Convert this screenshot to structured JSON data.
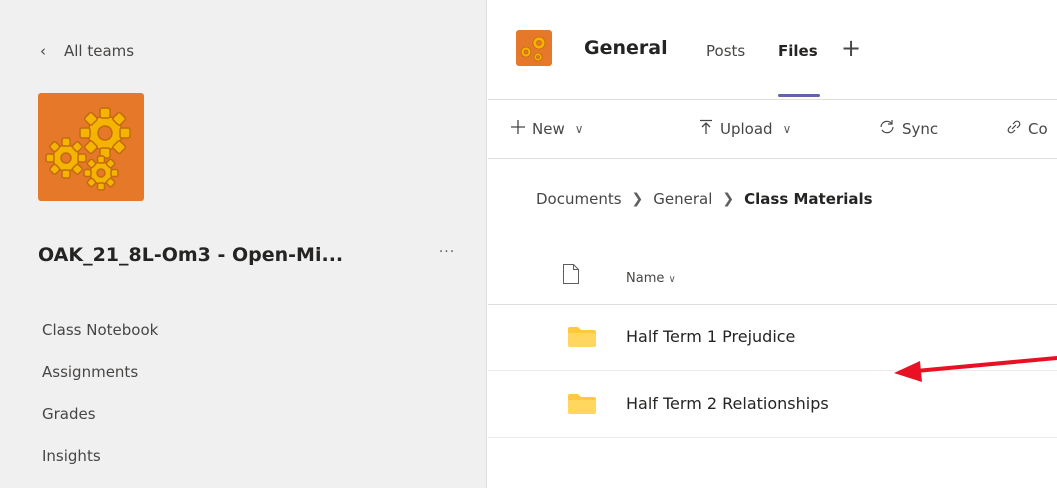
{
  "sidebar": {
    "back_label": "All teams",
    "team_name": "OAK_21_8L-Om3 - Open-Mi...",
    "more_label": "···",
    "nav_items": [
      {
        "label": "Class Notebook"
      },
      {
        "label": "Assignments"
      },
      {
        "label": "Grades"
      },
      {
        "label": "Insights"
      }
    ]
  },
  "header": {
    "channel_title": "General",
    "tabs": [
      {
        "label": "Posts",
        "active": false
      },
      {
        "label": "Files",
        "active": true
      }
    ],
    "add_tab_label": "+"
  },
  "toolbar": {
    "new_label": "New",
    "upload_label": "Upload",
    "sync_label": "Sync",
    "copy_label": "Co"
  },
  "breadcrumb": {
    "items": [
      "Documents",
      "General",
      "Class Materials"
    ]
  },
  "file_list": {
    "name_header": "Name",
    "rows": [
      {
        "name": "Half Term 1 Prejudice",
        "type": "folder"
      },
      {
        "name": "Half Term 2 Relationships",
        "type": "folder"
      }
    ]
  },
  "annotation": {
    "arrow_color": "#e81123"
  },
  "colors": {
    "team_logo_bg": "#e6782a",
    "accent": "#6264a7",
    "folder": "#ffc83d"
  }
}
